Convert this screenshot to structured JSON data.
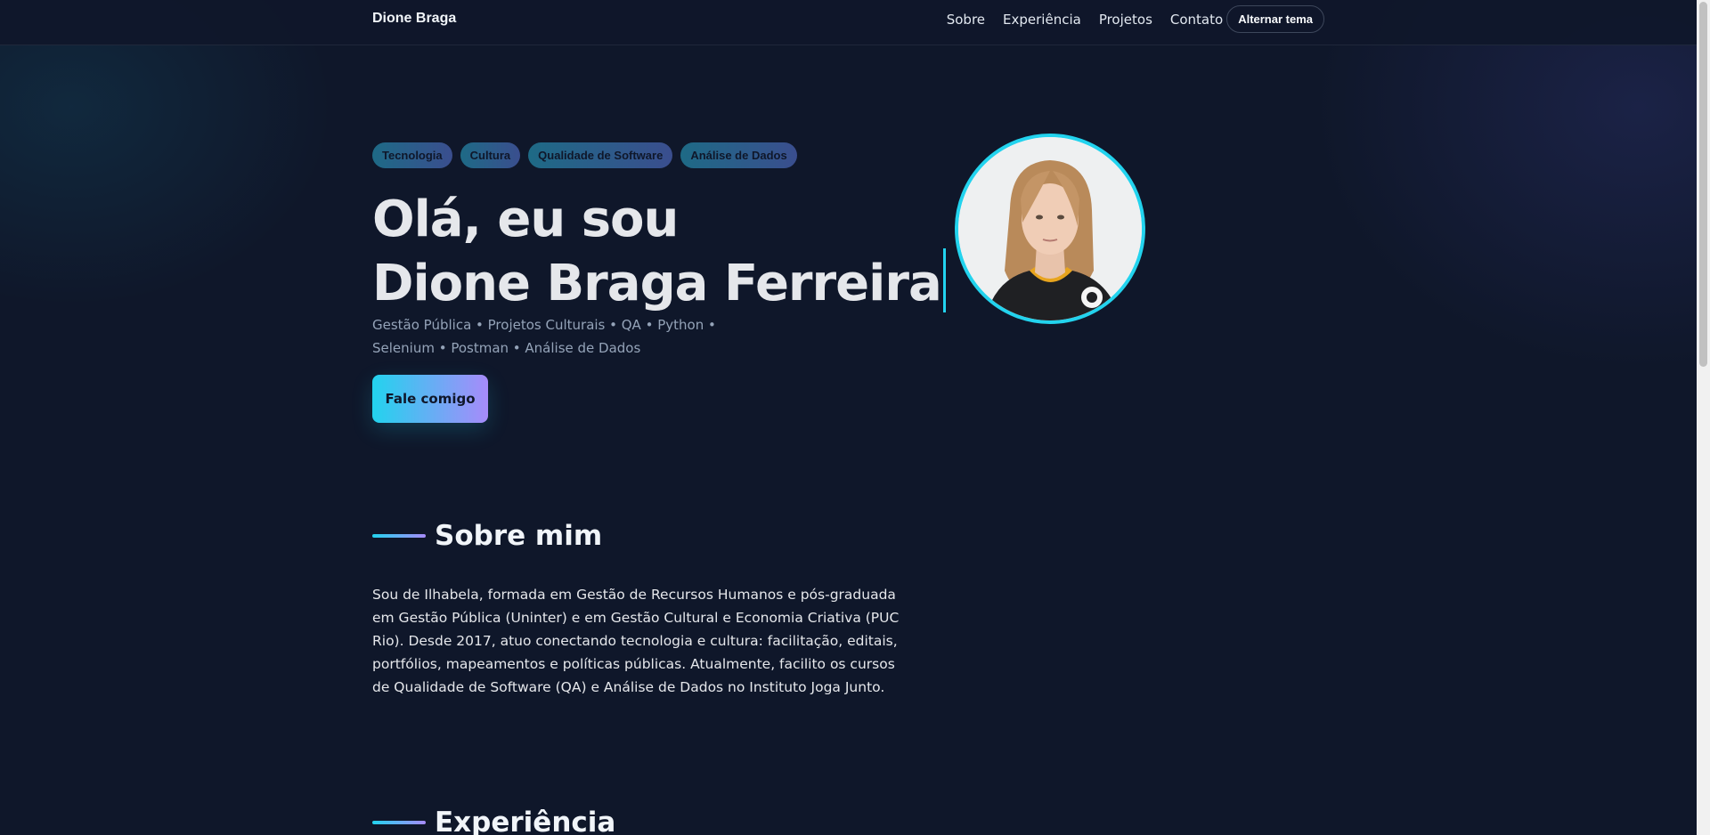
{
  "header": {
    "brand": "Dione Braga",
    "nav": [
      "Sobre",
      "Experiência",
      "Projetos",
      "Contato"
    ],
    "theme_toggle": "Alternar tema"
  },
  "hero": {
    "tags": [
      "Tecnologia",
      "Cultura",
      "Qualidade de Software",
      "Análise de Dados"
    ],
    "title_line1": "Olá, eu sou",
    "title_line2": "Dione Braga Ferreira",
    "subtitle": "Gestão Pública • Projetos Culturais • QA • Python • Selenium • Postman • Análise de Dados",
    "cta": "Fale comigo"
  },
  "about": {
    "title": "Sobre mim",
    "text": "Sou de Ilhabela, formada em Gestão de Recursos Humanos e pós-graduada em Gestão Pública (Uninter) e em Gestão Cultural e Economia Criativa (PUC Rio). Desde 2017, atuo conectando tecnologia e cultura: facilitação, editais, portfólios, mapeamentos e políticas públicas. Atualmente, facilito os cursos de Qualidade de Software (QA) e Análise de Dados no Instituto Joga Junto."
  },
  "experience": {
    "title": "Experiência"
  },
  "colors": {
    "background": "#0f172a",
    "accent_cyan": "#22d3ee",
    "accent_violet": "#a78bfa"
  },
  "icons": {
    "avatar": "profile-photo"
  }
}
